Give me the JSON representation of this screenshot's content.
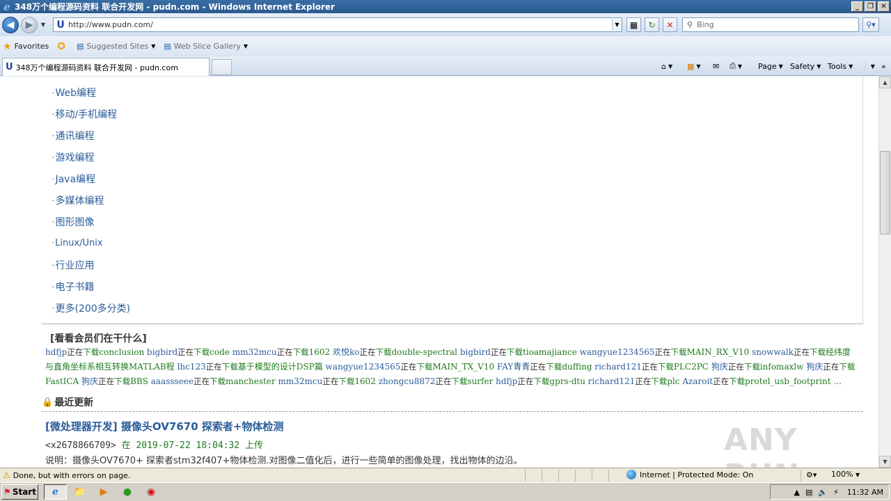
{
  "window": {
    "title": "348万个编程源码资料 联合开发网 - pudn.com - Windows Internet Explorer",
    "minimize": "_",
    "restore": "❐",
    "close": "✕"
  },
  "nav": {
    "url": "http://www.pudn.com/",
    "search_placeholder": "Bing"
  },
  "favorites": {
    "favorites_label": "Favorites",
    "suggested_sites": "Suggested Sites",
    "web_slice_gallery": "Web Slice Gallery"
  },
  "tabs": [
    {
      "label": "348万个编程源码资料 联合开发网 - pudn.com"
    }
  ],
  "commands": {
    "page": "Page",
    "safety": "Safety",
    "tools": "Tools"
  },
  "categories": [
    "Web编程",
    "移动/手机编程",
    "通讯编程",
    "游戏编程",
    "Java编程",
    "多媒体编程",
    "图形图像",
    "Linux/Unix",
    "行业应用",
    "电子书籍",
    "更多(200多分类)"
  ],
  "watch": {
    "title": "[看看会员们在干什么]",
    "doing_text": "正在",
    "download_text": "下载",
    "entries": [
      {
        "user": "hdfjp",
        "item": "conclusion"
      },
      {
        "user": "bigbird",
        "item": "code"
      },
      {
        "user": "mm32mcu",
        "item": "1602"
      },
      {
        "user": "欢悦ko",
        "item": "double-spectral"
      },
      {
        "user": "bigbird",
        "item": "tioamajiance"
      },
      {
        "user": "wangyue1234565",
        "item": "MAIN_RX_V10"
      },
      {
        "user": "snowwalk",
        "item": "经纬度与直角坐标系相互转换MATLAB程"
      },
      {
        "user": "lhc123",
        "item": "基于模型的设计DSP篇"
      },
      {
        "user": "wangyue1234565",
        "item": "MAIN_TX_V10"
      },
      {
        "user": "FAY青青",
        "item": "duffing"
      },
      {
        "user": "richard121",
        "item": "PLC2PC"
      },
      {
        "user": "狗庆",
        "item": "infomaxlw"
      },
      {
        "user": "狗庆",
        "item": "FastICA"
      },
      {
        "user": "狗庆",
        "item": "BBS"
      },
      {
        "user": "aaassseee",
        "item": "manchester"
      },
      {
        "user": "mm32mcu",
        "item": "1602"
      },
      {
        "user": "zhongcu8872",
        "item": "surfer"
      },
      {
        "user": "hdfjp",
        "item": "gprs-dtu"
      },
      {
        "user": "richard121",
        "item": "plc"
      },
      {
        "user": "Azaroit",
        "item": "protel_usb_footprint"
      }
    ],
    "ellipsis": "..."
  },
  "recent": {
    "heading": "最近更新",
    "post_title": "[微处理器开发] 摄像头OV7670 探索者+物体检测",
    "uploader": "<x2678866709>",
    "at": "在",
    "datetime": "2019-07-22 18:04:32",
    "action": "上传",
    "description": "说明：摄像头OV7670+ 探索者stm32f407+物体检测.对图像二值化后，进行一些简单的图像处理，找出物体的边沿。"
  },
  "status": {
    "message": "Done, but with errors on page.",
    "zone": "Internet | Protected Mode: On",
    "zoom": "100%"
  },
  "taskbar": {
    "start": "Start",
    "clock": "11:32 AM"
  },
  "watermark": "ANY RUN"
}
